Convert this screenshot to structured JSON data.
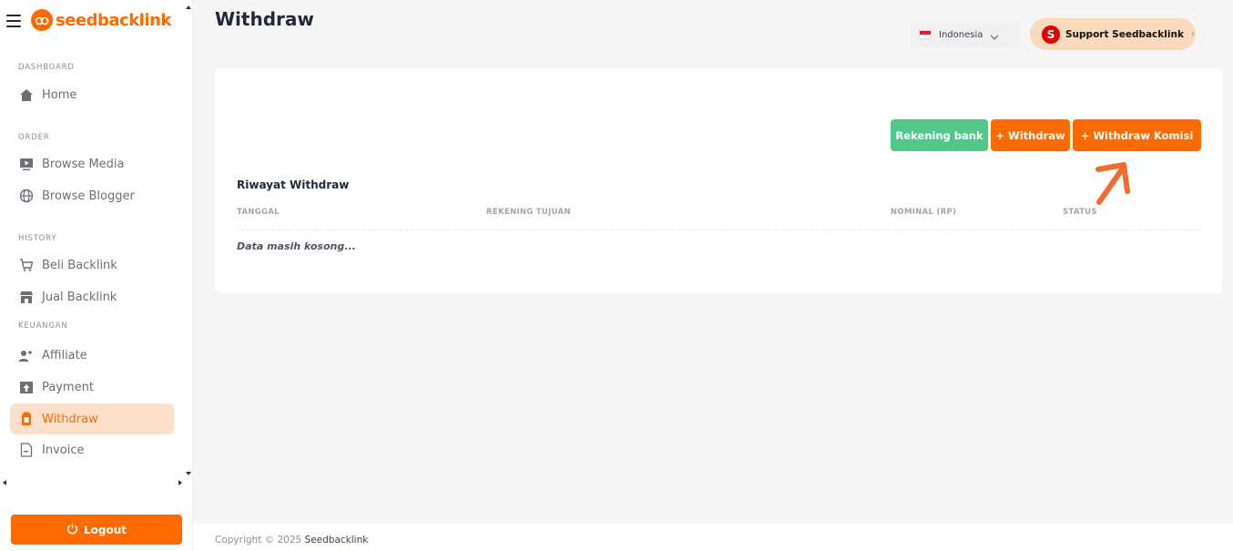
{
  "brand": {
    "name": "seedbacklink",
    "color": "#ff6a00"
  },
  "sidebar": {
    "sections": [
      {
        "label": "DASHBOARD"
      },
      {
        "label": "ORDER"
      },
      {
        "label": "HISTORY"
      },
      {
        "label": "KEUANGAN"
      }
    ],
    "items": [
      {
        "label": "Home",
        "icon": "home-icon"
      },
      {
        "label": "Browse Media",
        "icon": "play-monitor-icon"
      },
      {
        "label": "Browse Blogger",
        "icon": "globe-icon"
      },
      {
        "label": "Beli Backlink",
        "icon": "cart-icon"
      },
      {
        "label": "Jual Backlink",
        "icon": "store-icon"
      },
      {
        "label": "Affiliate",
        "icon": "users-plus-icon"
      },
      {
        "label": "Payment",
        "icon": "upload-box-icon"
      },
      {
        "label": "Withdraw",
        "icon": "wallet-icon",
        "active": true
      },
      {
        "label": "Invoice",
        "icon": "document-icon"
      }
    ],
    "logout_label": "Logout"
  },
  "header": {
    "title": "Withdraw",
    "language": "Indonesia",
    "support_initial": "S",
    "support_label": "Support Seedbacklink",
    "support_chevron": "›"
  },
  "card": {
    "buttons": {
      "bank": "Rekening bank",
      "withdraw": "+ Withdraw",
      "komisi": "+ Withdraw Komisi"
    },
    "subtitle": "Riwayat Withdraw",
    "columns": [
      "TANGGAL",
      "REKENING TUJUAN",
      "NOMINAL (RP)",
      "STATUS"
    ],
    "empty_text": "Data masih kosong..."
  },
  "footer": {
    "copyright": "Copyright © 2025",
    "brand": "Seedbacklink"
  },
  "colors": {
    "accent": "#ff6a00",
    "success": "#4fc88a",
    "active_bg": "#fde0cc"
  }
}
